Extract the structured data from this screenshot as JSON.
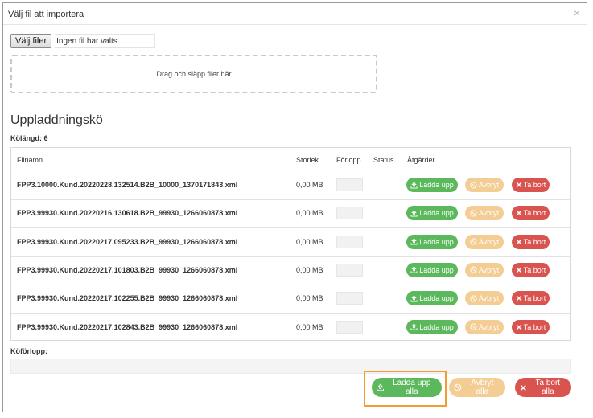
{
  "dialog": {
    "title": "Välj fil att importera",
    "close_glyph": "×"
  },
  "file_picker": {
    "button_label": "Välj filer",
    "status_text": "Ingen fil har valts"
  },
  "dropzone": {
    "text": "Drag och släpp filer här"
  },
  "queue": {
    "heading": "Uppladdningskö",
    "length_label": "Kölängd:",
    "length_value": "6",
    "columns": [
      "Filnamn",
      "Storlek",
      "Förlopp",
      "Status",
      "Åtgärder"
    ],
    "rows": [
      {
        "filename": "FPP3.10000.Kund.20220228.132514.B2B_10000_1370171843.xml",
        "size": "0,00 MB",
        "status": ""
      },
      {
        "filename": "FPP3.99930.Kund.20220216.130618.B2B_99930_1266060878.xml",
        "size": "0,00 MB",
        "status": ""
      },
      {
        "filename": "FPP3.99930.Kund.20220217.095233.B2B_99930_1266060878.xml",
        "size": "0,00 MB",
        "status": ""
      },
      {
        "filename": "FPP3.99930.Kund.20220217.101803.B2B_99930_1266060878.xml",
        "size": "0,00 MB",
        "status": ""
      },
      {
        "filename": "FPP3.99930.Kund.20220217.102255.B2B_99930_1266060878.xml",
        "size": "0,00 MB",
        "status": ""
      },
      {
        "filename": "FPP3.99930.Kund.20220217.102843.B2B_99930_1266060878.xml",
        "size": "0,00 MB",
        "status": ""
      }
    ],
    "actions": {
      "upload": "Ladda upp",
      "cancel": "Avbryt",
      "delete": "Ta bort"
    }
  },
  "queue_progress": {
    "label": "Köförlopp:"
  },
  "footer": {
    "upload_all": "Ladda upp alla",
    "cancel_all": "Avbryt alla",
    "delete_all": "Ta bort alla"
  },
  "colors": {
    "success": "#5cb85c",
    "warning": "#f3cd94",
    "danger": "#d9534f",
    "highlight": "#f39a33"
  },
  "icons": {
    "upload": "upload-icon",
    "cancel": "ban-icon",
    "delete": "close-icon"
  }
}
